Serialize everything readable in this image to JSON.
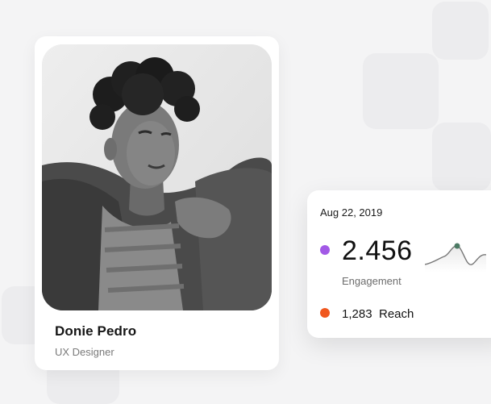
{
  "profile": {
    "name": "Donie Pedro",
    "role": "UX Designer",
    "photo_alt": "Portrait of Donie Pedro"
  },
  "stats": {
    "date": "Aug 22, 2019",
    "engagement_value": "2.456",
    "engagement_label": "Engagement",
    "reach_value": "1,283",
    "reach_label": "Reach"
  },
  "colors": {
    "engagement_dot": "#a259e6",
    "reach_dot": "#f0571e",
    "sparkline_marker": "#4c7a64"
  },
  "icons": {
    "engagement_marker": "dot-icon",
    "reach_marker": "dot-icon"
  }
}
